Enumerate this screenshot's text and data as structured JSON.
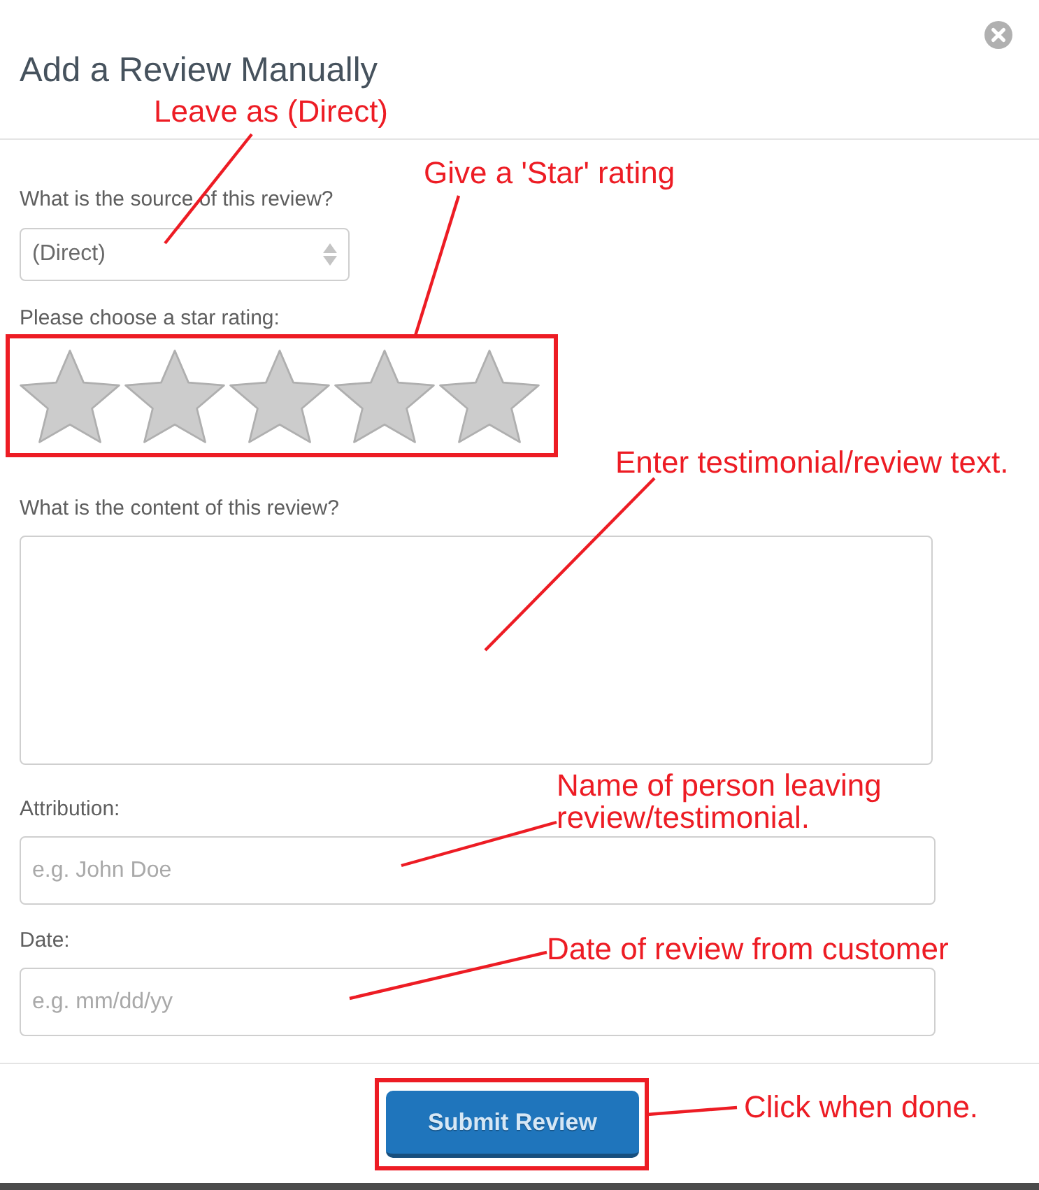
{
  "dialog": {
    "title": "Add a Review Manually"
  },
  "fields": [
    {
      "kind": "select",
      "label": "What is the source of this review?",
      "value": "(Direct)"
    },
    {
      "kind": "stars",
      "label": "Please choose a star rating:",
      "stars": 0
    },
    {
      "kind": "textarea",
      "label": "What is the content of this review?"
    },
    {
      "kind": "input",
      "label": "Attribution:",
      "placeholder": "e.g. John Doe"
    },
    {
      "kind": "input",
      "label": "Date:",
      "placeholder": "e.g. mm/dd/yy"
    }
  ],
  "submit_button": {
    "label": "Submit Review"
  },
  "annotations": [
    {
      "text": "Leave as (Direct)"
    },
    {
      "text": "Give a 'Star' rating"
    },
    {
      "text": "Enter testimonial/review text."
    },
    {
      "text": "Name of person leaving review/testimonial."
    },
    {
      "text": "Date of review from customer"
    },
    {
      "text": "Click when done."
    }
  ]
}
